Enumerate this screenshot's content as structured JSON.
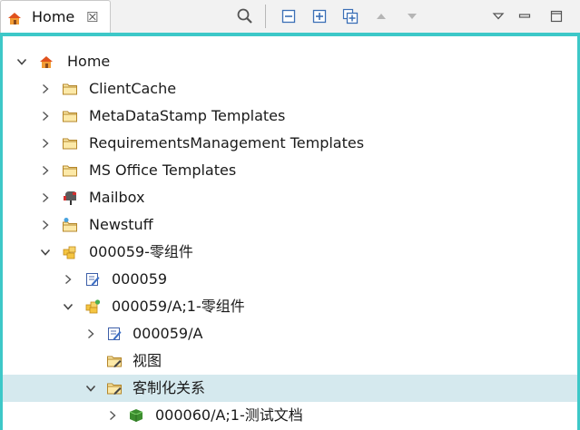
{
  "tab": {
    "title": "Home",
    "close": "☒",
    "icon": "home-icon"
  },
  "toolbar": {
    "items": [
      {
        "name": "search-icon"
      },
      {
        "name": "collapse-all-icon"
      },
      {
        "name": "expand-all-icon"
      },
      {
        "name": "expand-selected-icon"
      },
      {
        "name": "arrow-up-icon"
      },
      {
        "name": "arrow-down-icon"
      },
      {
        "name": "view-menu-icon"
      },
      {
        "name": "minimize-icon"
      },
      {
        "name": "maximize-icon"
      }
    ]
  },
  "colors": {
    "accent": "#3dc8c8",
    "selection": "#d5e9ee",
    "folder": "#f5c542"
  },
  "tree": {
    "nodes": [
      {
        "label": "Home",
        "icon": "home-icon",
        "expanded": true
      },
      {
        "label": "ClientCache",
        "icon": "folder-icon",
        "expanded": false
      },
      {
        "label": "MetaDataStamp Templates",
        "icon": "folder-icon",
        "expanded": false
      },
      {
        "label": "RequirementsManagement Templates",
        "icon": "folder-icon",
        "expanded": false
      },
      {
        "label": "MS Office Templates",
        "icon": "folder-icon",
        "expanded": false
      },
      {
        "label": "Mailbox",
        "icon": "mailbox-icon",
        "expanded": false
      },
      {
        "label": "Newstuff",
        "icon": "newstuff-folder-icon",
        "expanded": false
      },
      {
        "label": "000059-零组件",
        "icon": "item-icon",
        "expanded": true
      },
      {
        "label": "000059",
        "icon": "item-master-icon",
        "expanded": false
      },
      {
        "label": "000059/A;1-零组件",
        "icon": "item-revision-icon",
        "expanded": true
      },
      {
        "label": "000059/A",
        "icon": "item-master-icon",
        "expanded": false
      },
      {
        "label": "视图",
        "icon": "pseudo-folder-icon",
        "expanded": null
      },
      {
        "label": "客制化关系",
        "icon": "pseudo-folder-icon",
        "expanded": true,
        "selected": true
      },
      {
        "label": "000060/A;1-测试文档",
        "icon": "document-revision-icon",
        "expanded": false
      }
    ]
  }
}
